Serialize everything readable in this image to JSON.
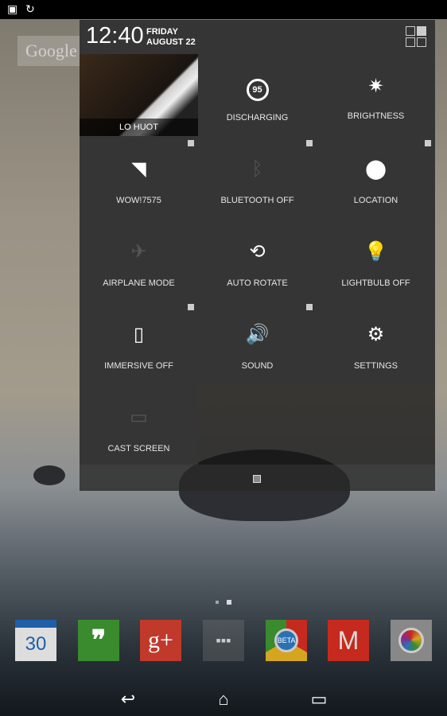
{
  "status_bar": {
    "icons": [
      "image-icon",
      "sync-icon"
    ]
  },
  "header": {
    "time": "12:40",
    "day": "FRIDAY",
    "date": "AUGUST 22"
  },
  "user": {
    "name": "LO HUOT"
  },
  "tiles": [
    {
      "label": "DISCHARGING",
      "icon": "battery-icon",
      "value": "95",
      "state": "on"
    },
    {
      "label": "BRIGHTNESS",
      "icon": "brightness-icon",
      "state": "on"
    },
    {
      "label": "WOW!7575",
      "icon": "wifi-icon",
      "state": "on"
    },
    {
      "label": "BLUETOOTH OFF",
      "icon": "bluetooth-icon",
      "state": "off"
    },
    {
      "label": "LOCATION",
      "icon": "location-icon",
      "state": "on"
    },
    {
      "label": "AIRPLANE MODE",
      "icon": "airplane-icon",
      "state": "off"
    },
    {
      "label": "AUTO ROTATE",
      "icon": "rotate-icon",
      "state": "on"
    },
    {
      "label": "LIGHTBULB OFF",
      "icon": "lightbulb-icon",
      "state": "off"
    },
    {
      "label": "IMMERSIVE OFF",
      "icon": "immersive-icon",
      "state": "on"
    },
    {
      "label": "SOUND",
      "icon": "sound-icon",
      "state": "on"
    },
    {
      "label": "SETTINGS",
      "icon": "settings-icon",
      "state": "on"
    },
    {
      "label": "CAST SCREEN",
      "icon": "cast-icon",
      "state": "off"
    }
  ],
  "wallpaper_widget": {
    "text": "Google"
  },
  "dock": {
    "calendar_day": "30",
    "chrome_badge": "BETA",
    "apps": [
      "calendar",
      "hangouts",
      "google-plus",
      "app-drawer",
      "chrome-beta",
      "gmail",
      "camera"
    ]
  },
  "colors": {
    "panel": "#353535",
    "hangouts": "#3a8a2e",
    "gplus": "#c0392b",
    "gmail": "#c62a1e",
    "calendar_blue": "#1f5fa8"
  }
}
